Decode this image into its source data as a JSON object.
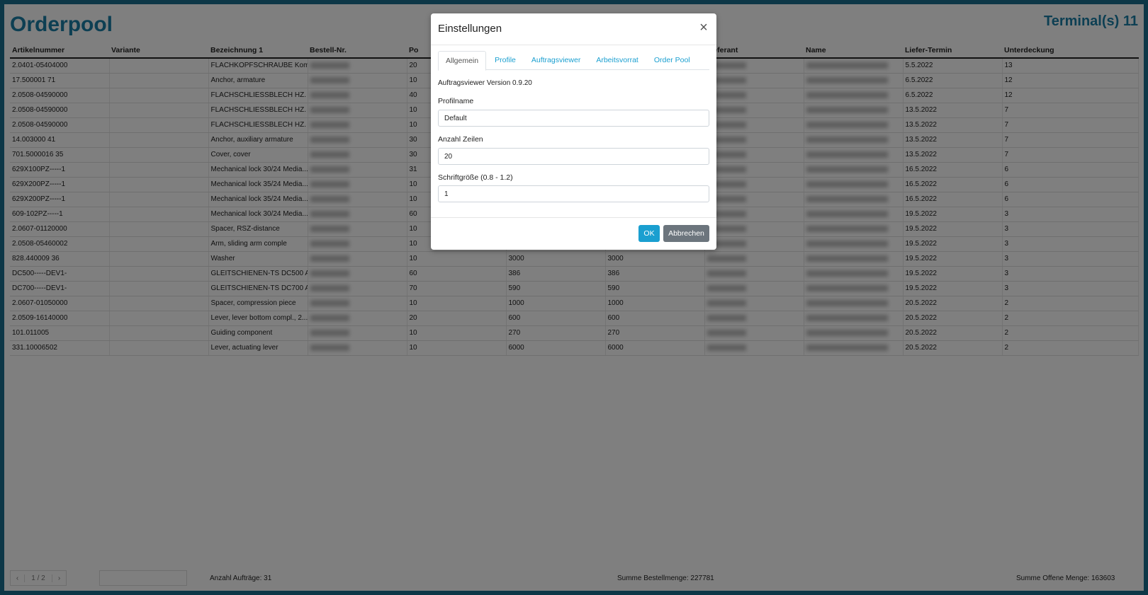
{
  "app": {
    "title": "Orderpool",
    "terminal": "Terminal(s) 11"
  },
  "table": {
    "columns": [
      "Artikelnummer",
      "Variante",
      "Bezeichnung 1",
      "Bestell-Nr.",
      "Po",
      "",
      "",
      "Lieferant",
      "Name",
      "Liefer-Termin",
      "Unterdeckung"
    ],
    "rows": [
      [
        "2.0401-05404000",
        "",
        "FLACHKOPFSCHRAUBE Kom...",
        "",
        "20",
        "",
        "",
        "",
        "",
        "5.5.2022",
        "13"
      ],
      [
        "17.500001 71",
        "",
        "Anchor, armature",
        "",
        "10",
        "",
        "",
        "",
        "",
        "6.5.2022",
        "12"
      ],
      [
        "2.0508-04590000",
        "",
        "FLACHSCHLIESSBLECH HZ. E...",
        "",
        "40",
        "",
        "",
        "",
        "",
        "6.5.2022",
        "12"
      ],
      [
        "2.0508-04590000",
        "",
        "FLACHSCHLIESSBLECH HZ. E...",
        "",
        "10",
        "",
        "",
        "",
        "",
        "13.5.2022",
        "7"
      ],
      [
        "2.0508-04590000",
        "",
        "FLACHSCHLIESSBLECH HZ. E...",
        "",
        "10",
        "",
        "",
        "",
        "",
        "13.5.2022",
        "7"
      ],
      [
        "14.003000 41",
        "",
        "Anchor, auxiliary armature",
        "",
        "30",
        "",
        "",
        "",
        "",
        "13.5.2022",
        "7"
      ],
      [
        "701.5000016 35",
        "",
        "Cover, cover",
        "",
        "30",
        "",
        "",
        "",
        "",
        "13.5.2022",
        "7"
      ],
      [
        "629X100PZ-----1",
        "",
        "Mechanical lock 30/24 Media...",
        "",
        "31",
        "",
        "",
        "",
        "",
        "16.5.2022",
        "6"
      ],
      [
        "629X200PZ-----1",
        "",
        "Mechanical lock 35/24 Media...",
        "",
        "10",
        "",
        "",
        "",
        "",
        "16.5.2022",
        "6"
      ],
      [
        "629X200PZ-----1",
        "",
        "Mechanical lock 35/24 Media...",
        "",
        "10",
        "",
        "",
        "",
        "",
        "16.5.2022",
        "6"
      ],
      [
        "609-102PZ-----1",
        "",
        "Mechanical lock 30/24 Media...",
        "",
        "60",
        "",
        "",
        "",
        "",
        "19.5.2022",
        "3"
      ],
      [
        "2.0607-01120000",
        "",
        "Spacer, RSZ-distance",
        "",
        "10",
        "",
        "",
        "",
        "",
        "19.5.2022",
        "3"
      ],
      [
        "2.0508-05460002",
        "",
        "Arm, sliding arm comple",
        "",
        "10",
        "",
        "",
        "",
        "",
        "19.5.2022",
        "3"
      ],
      [
        "828.440009 36",
        "",
        "Washer",
        "",
        "10",
        "3000",
        "3000",
        "",
        "",
        "19.5.2022",
        "3"
      ],
      [
        "DC500-----DEV1-",
        "",
        "GLEITSCHIENEN-TS DC500 A...",
        "",
        "60",
        "386",
        "386",
        "",
        "",
        "19.5.2022",
        "3"
      ],
      [
        "DC700-----DEV1-",
        "",
        "GLEITSCHIENEN-TS DC700 A...",
        "",
        "70",
        "590",
        "590",
        "",
        "",
        "19.5.2022",
        "3"
      ],
      [
        "2.0607-01050000",
        "",
        "Spacer, compression piece",
        "",
        "10",
        "1000",
        "1000",
        "",
        "",
        "20.5.2022",
        "2"
      ],
      [
        "2.0509-16140000",
        "",
        "Lever, lever bottom compl., 2...",
        "",
        "20",
        "600",
        "600",
        "",
        "",
        "20.5.2022",
        "2"
      ],
      [
        "101.011005",
        "",
        "Guiding component",
        "",
        "10",
        "270",
        "270",
        "",
        "",
        "20.5.2022",
        "2"
      ],
      [
        "331.10006502",
        "",
        "Lever, actuating lever",
        "",
        "10",
        "6000",
        "6000",
        "",
        "",
        "20.5.2022",
        "2"
      ]
    ]
  },
  "footer": {
    "prev": "‹",
    "page_info": "1 / 2",
    "next": "›",
    "anzahl": "Anzahl Aufträge: 31",
    "summe_bestell": "Summe Bestellmenge: 227781",
    "summe_offen": "Summe Offene Menge: 163603"
  },
  "modal": {
    "title": "Einstellungen",
    "close": "×",
    "tabs": [
      "Allgemein",
      "Profile",
      "Auftragsviewer",
      "Arbeitsvorrat",
      "Order Pool"
    ],
    "version": "Auftragsviewer Version 0.9.20",
    "profilname_label": "Profilname",
    "profilname_value": "Default",
    "zeilen_label": "Anzahl Zeilen",
    "zeilen_value": "20",
    "schrift_label": "Schriftgröße (0.8 - 1.2)",
    "schrift_value": "1",
    "ok": "OK",
    "cancel": "Abbrechen"
  },
  "colors": {
    "accent": "#1a7fa6",
    "link": "#1a9fd0",
    "frame": "#1a6f8f",
    "cancel": "#6c757d"
  }
}
